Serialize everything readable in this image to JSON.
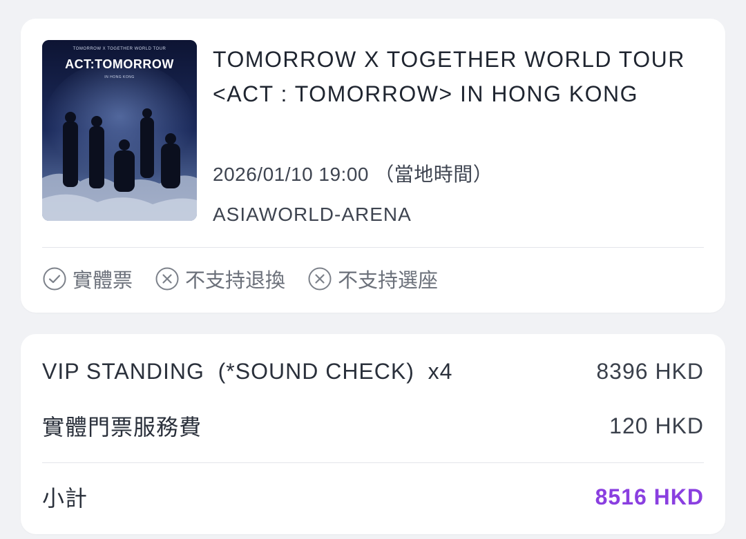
{
  "event": {
    "poster": {
      "top_text": "TOMORROW X TOGETHER WORLD TOUR",
      "logo_text": "ACT:TOMORROW",
      "sub_text": "IN HONG KONG"
    },
    "title": "TOMORROW X TOGETHER WORLD TOUR <ACT : TOMORROW> IN HONG KONG",
    "datetime": "2026/01/10 19:00 （當地時間）",
    "venue": "ASIAWORLD-ARENA",
    "features": [
      {
        "label": "實體票",
        "icon": "check-circle-icon",
        "supported": true
      },
      {
        "label": "不支持退換",
        "icon": "x-circle-icon",
        "supported": false
      },
      {
        "label": "不支持選座",
        "icon": "x-circle-icon",
        "supported": false
      }
    ]
  },
  "order": {
    "ticket": {
      "label": "VIP STANDING  (*SOUND CHECK)  x4",
      "amount": "8396 HKD"
    },
    "fee": {
      "label": "實體門票服務費",
      "amount": "120 HKD"
    },
    "subtotal": {
      "label": "小計",
      "amount": "8516 HKD"
    }
  },
  "colors": {
    "accent": "#8a3fe0",
    "background": "#f1f2f5",
    "card": "#ffffff"
  }
}
